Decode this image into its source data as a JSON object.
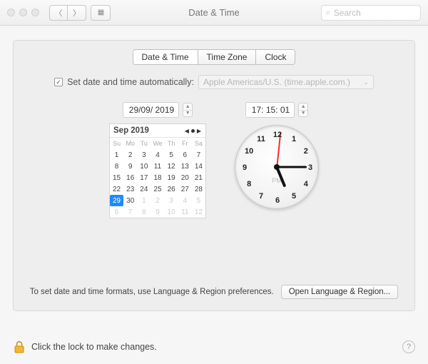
{
  "window": {
    "title": "Date & Time",
    "search_placeholder": "Search"
  },
  "tabs": {
    "date_time": "Date & Time",
    "time_zone": "Time Zone",
    "clock": "Clock",
    "active": "date_time"
  },
  "auto": {
    "checked": true,
    "label": "Set date and time automatically:",
    "server": "Apple Americas/U.S. (time.apple.com.)"
  },
  "date": {
    "field_value": "29/09/ 2019",
    "calendar": {
      "header": "Sep 2019",
      "dow": [
        "Su",
        "Mo",
        "Tu",
        "We",
        "Th",
        "Fr",
        "Sa"
      ],
      "leading_dim": [],
      "days": [
        1,
        2,
        3,
        4,
        5,
        6,
        7,
        8,
        9,
        10,
        11,
        12,
        13,
        14,
        15,
        16,
        17,
        18,
        19,
        20,
        21,
        22,
        23,
        24,
        25,
        26,
        27,
        28,
        29,
        30
      ],
      "trailing_dim": [
        1,
        2,
        3,
        4,
        5,
        6,
        7,
        8,
        9,
        10,
        11,
        12
      ],
      "selected_day": 29
    }
  },
  "time": {
    "field_value": "17: 15: 01",
    "hours": 17,
    "minutes": 15,
    "seconds": 1,
    "ampm": "PM",
    "face_numbers": [
      12,
      1,
      2,
      3,
      4,
      5,
      6,
      7,
      8,
      9,
      10,
      11
    ]
  },
  "panel_footer": {
    "text": "To set date and time formats, use Language & Region preferences.",
    "button": "Open Language & Region..."
  },
  "footer": {
    "lock_text": "Click the lock to make changes.",
    "help": "?"
  }
}
